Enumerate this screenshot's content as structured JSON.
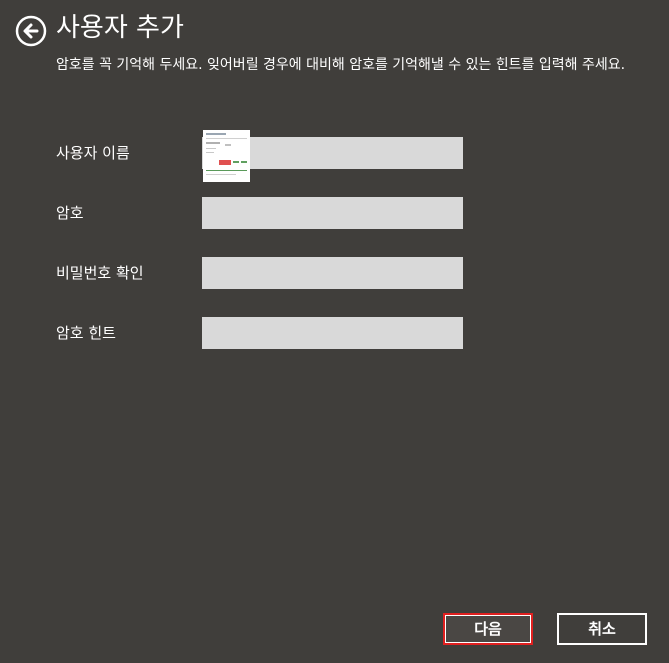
{
  "header": {
    "title": "사용자 추가",
    "back_icon": "arrow-left-circle-icon"
  },
  "instructions": "암호를 꼭 기억해 두세요. 잊어버릴 경우에 대비해 암호를 기억해낼 수 있는 힌트를 입력해 주세요.",
  "form": {
    "username": {
      "label": "사용자 이름",
      "value": ""
    },
    "password": {
      "label": "암호",
      "value": ""
    },
    "confirm_password": {
      "label": "비밀번호 확인",
      "value": ""
    },
    "password_hint": {
      "label": "암호 힌트",
      "value": ""
    }
  },
  "buttons": {
    "next": "다음",
    "cancel": "취소"
  },
  "colors": {
    "background": "#403e3b",
    "input_background": "#d9d9d9",
    "focus_border": "#e02020",
    "text": "#ffffff"
  }
}
